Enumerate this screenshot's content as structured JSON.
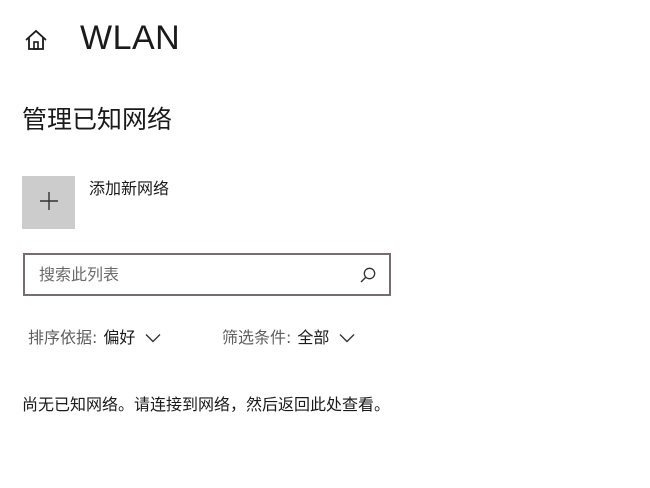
{
  "header": {
    "title": "WLAN",
    "home_icon": "home-icon"
  },
  "section": {
    "heading": "管理已知网络"
  },
  "add_network": {
    "icon": "plus-icon",
    "label": "添加新网络"
  },
  "search": {
    "placeholder": "搜索此列表",
    "value": "",
    "icon": "search-icon"
  },
  "sort": {
    "key_label": "排序依据:",
    "value": "偏好"
  },
  "filter": {
    "key_label": "筛选条件:",
    "value": "全部"
  },
  "empty_message": "尚无已知网络。请连接到网络，然后返回此处查看。",
  "colors": {
    "add_tile": "#cccccc",
    "search_border": "#7a6b72",
    "muted_text": "#5f5f5f"
  }
}
